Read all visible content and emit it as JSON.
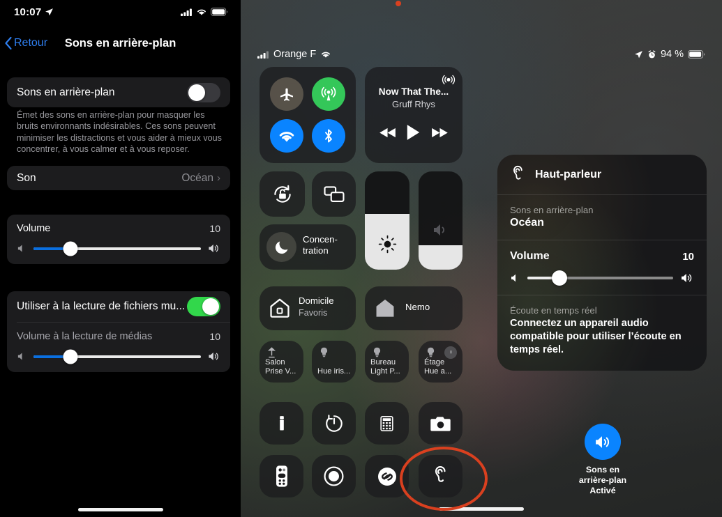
{
  "settings": {
    "status_bar": {
      "time": "10:07",
      "location_icon": "location-arrow-icon",
      "signal_icon": "cellular-signal-icon",
      "wifi_icon": "wifi-icon",
      "battery_icon": "battery-icon"
    },
    "nav": {
      "back_label": "Retour",
      "title": "Sons en arrière-plan",
      "back_icon": "chevron-left-icon"
    },
    "toggle_row": {
      "label": "Sons en arrière-plan",
      "state": "off"
    },
    "footnote": "Émet des sons en arrière-plan pour masquer les bruits environnants indésirables. Ces sons peuvent minimiser les distractions et vous aider à mieux vous concentrer, à vous calmer et à vous reposer.",
    "sound_row": {
      "label": "Son",
      "value": "Océan",
      "chevron": "›"
    },
    "volume": {
      "label": "Volume",
      "value": "10",
      "percent": 22,
      "low_icon": "speaker-low-icon",
      "high_icon": "speaker-high-icon"
    },
    "media_toggle": {
      "label": "Utiliser à la lecture de fichiers mu...",
      "state": "on"
    },
    "media_volume": {
      "label": "Volume à la lecture de médias",
      "value": "10",
      "percent": 22,
      "low_icon": "speaker-low-icon",
      "high_icon": "speaker-high-icon"
    }
  },
  "control_center": {
    "status_bar": {
      "carrier": "Orange F",
      "signal_icon": "cellular-signal-icon",
      "wifi_icon": "wifi-icon",
      "location_icon": "location-arrow-icon",
      "alarm_icon": "alarm-clock-icon",
      "battery_percent": "94 %",
      "battery_icon": "battery-icon"
    },
    "connectivity": {
      "airplane": {
        "icon": "airplane-icon",
        "state": "off"
      },
      "cellular": {
        "icon": "cellular-antenna-icon",
        "state": "on"
      },
      "wifi": {
        "icon": "wifi-icon",
        "state": "on"
      },
      "bluetooth": {
        "icon": "bluetooth-icon",
        "state": "on"
      }
    },
    "media": {
      "title": "Now That The...",
      "artist": "Gruff Rhys",
      "airplay_icon": "airplay-audio-icon",
      "prev_icon": "rewind-icon",
      "play_icon": "play-icon",
      "next_icon": "fast-forward-icon"
    },
    "rotation_lock": {
      "icon": "rotation-lock-icon"
    },
    "screen_mirroring": {
      "icon": "screen-mirroring-icon"
    },
    "focus": {
      "label": "Concen-\ntration",
      "icon": "moon-icon"
    },
    "brightness": {
      "icon": "brightness-icon",
      "percent": 57
    },
    "volume": {
      "icon": "speaker-icon",
      "percent": 25
    },
    "home_tiles": [
      {
        "name": "home-favorites-tile",
        "label": "Domicile",
        "sublabel": "Favoris",
        "icon": "house-outline-icon"
      },
      {
        "name": "home-nemo-tile",
        "label": "Nemo",
        "sublabel": "",
        "icon": "house-filled-icon"
      }
    ],
    "device_tiles": [
      {
        "label": "Salon\nPrise V...",
        "icon": "lamp-icon"
      },
      {
        "label": "Hue iris...",
        "icon": "bulb-icon"
      },
      {
        "label": "Bureau\nLight P...",
        "icon": "bulb-icon"
      },
      {
        "label": "Étage\nHue a...",
        "icon": "bulb-icon"
      }
    ],
    "utilities_row1": [
      {
        "name": "flashlight-tile",
        "icon": "flashlight-icon"
      },
      {
        "name": "timer-tile",
        "icon": "timer-icon"
      },
      {
        "name": "calculator-tile",
        "icon": "calculator-icon"
      },
      {
        "name": "camera-tile",
        "icon": "camera-icon"
      }
    ],
    "utilities_row2": [
      {
        "name": "remote-tile",
        "icon": "apple-tv-remote-icon"
      },
      {
        "name": "screen-record-tile",
        "icon": "screen-record-icon"
      },
      {
        "name": "shazam-tile",
        "icon": "shazam-icon"
      },
      {
        "name": "hearing-tile",
        "icon": "ear-hearing-icon",
        "highlighted": true
      }
    ],
    "annotation": {
      "shape": "ellipse",
      "color": "#d9401f",
      "target": "hearing-tile"
    }
  },
  "hearing_popup": {
    "header": {
      "title": "Haut-parleur",
      "icon": "ear-hearing-icon"
    },
    "background_sounds": {
      "label": "Sons en arrière-plan",
      "value": "Océan"
    },
    "volume": {
      "label": "Volume",
      "value": "10",
      "percent": 22,
      "low_icon": "speaker-low-icon",
      "high_icon": "speaker-high-icon"
    },
    "live_listen": {
      "label": "Écoute en temps réel",
      "note": "Connectez un appareil audio compatible pour utiliser l’écoute en temps réel."
    }
  },
  "action_button": {
    "icon": "speaker-wave-icon",
    "color": "#0a84ff",
    "label": "Sons en\narrière-plan",
    "state": "Activé"
  }
}
